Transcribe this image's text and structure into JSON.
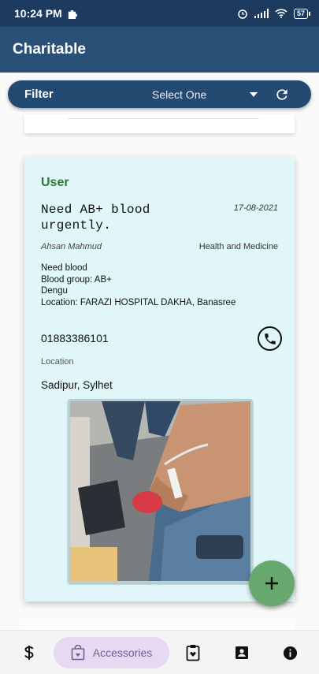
{
  "status_bar": {
    "time": "10:24 PM",
    "battery": "57"
  },
  "app_bar": {
    "title": "Charitable"
  },
  "filter": {
    "label": "Filter",
    "select_value": "Select One"
  },
  "post": {
    "badge": "User",
    "title": "Need AB+ blood urgently.",
    "date": "17-08-2021",
    "author": "Ahsan Mahmud",
    "category": "Health and Medicine",
    "description": [
      "Need blood",
      "Blood group: AB+",
      "Dengu",
      "Location: FARAZI HOSPITAL DAKHA, Banasree"
    ],
    "phone": "01883386101",
    "location_label": "Location",
    "location_value": "Sadipur, Sylhet"
  },
  "fab": {
    "icon": "plus-icon"
  },
  "bottom_nav": {
    "items": [
      {
        "icon": "dollar-icon"
      },
      {
        "icon": "shopping-bag-icon",
        "label": "Accessories",
        "active": true
      },
      {
        "icon": "clipboard-heart-icon"
      },
      {
        "icon": "contact-card-icon"
      },
      {
        "icon": "info-icon"
      }
    ]
  },
  "colors": {
    "app_bar": "#2b5078",
    "status_bar": "#1d3a5f",
    "card": "#e0f6f8",
    "badge": "#2e7a38",
    "fab": "#66a86e",
    "nav_pill": "#e6d9f2"
  }
}
